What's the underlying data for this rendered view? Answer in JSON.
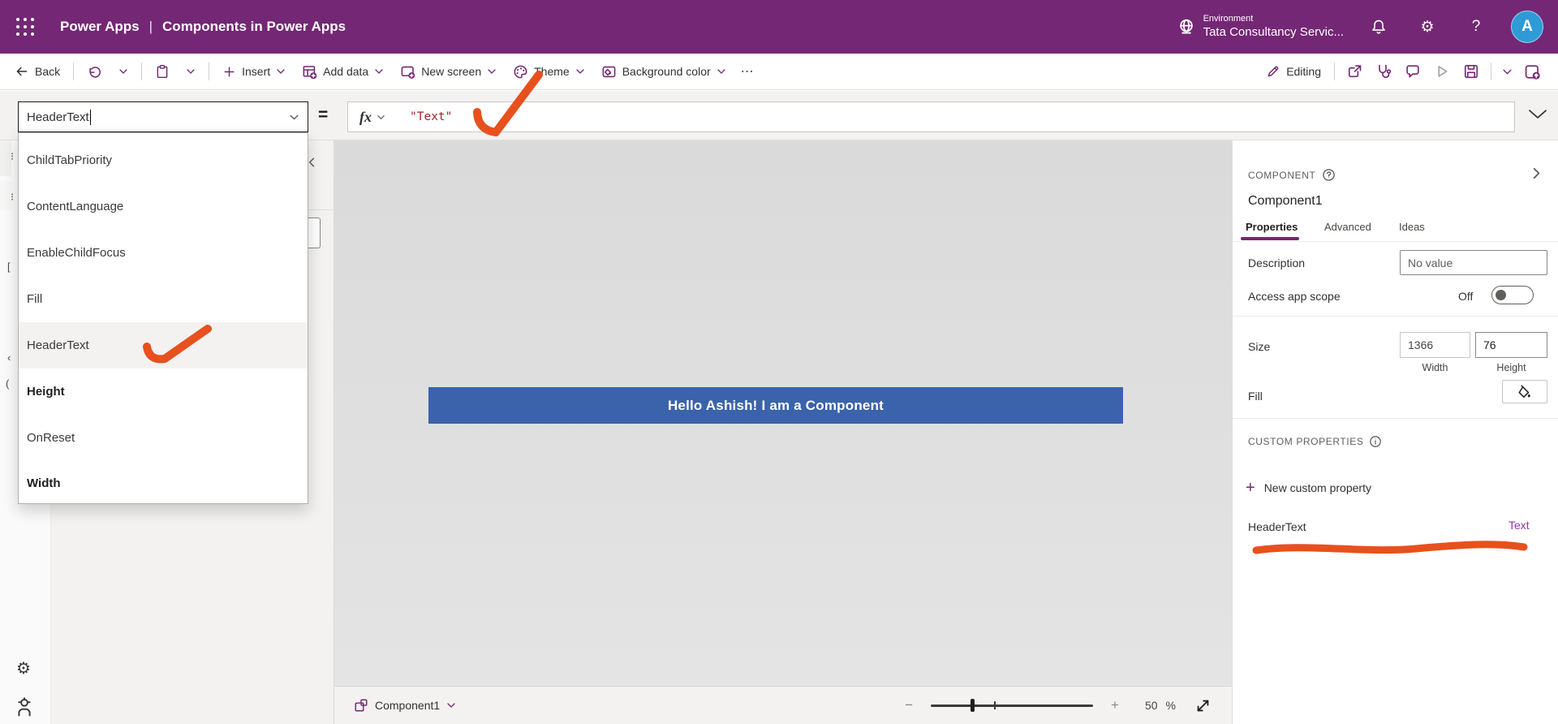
{
  "app": {
    "product": "Power Apps",
    "separator": "|",
    "title": "Components in Power Apps"
  },
  "environment": {
    "label": "Environment",
    "name": "Tata Consultancy Servic..."
  },
  "account": {
    "avatar_initial": "A",
    "help_glyph": "?"
  },
  "toolbar": {
    "back": "Back",
    "insert": "Insert",
    "add_data": "Add data",
    "new_screen": "New screen",
    "theme": "Theme",
    "background_color": "Background color",
    "overflow": "⋯",
    "editing": "Editing"
  },
  "formula_bar": {
    "property_value": "HeaderText",
    "equals": "=",
    "fx_label": "fx",
    "formula": "\"Text\""
  },
  "property_dropdown": {
    "items": [
      {
        "label": "ChildTabPriority",
        "bold": false,
        "selected": false
      },
      {
        "label": "ContentLanguage",
        "bold": false,
        "selected": false
      },
      {
        "label": "EnableChildFocus",
        "bold": false,
        "selected": false
      },
      {
        "label": "Fill",
        "bold": false,
        "selected": false
      },
      {
        "label": "HeaderText",
        "bold": false,
        "selected": true
      },
      {
        "label": "Height",
        "bold": true,
        "selected": false
      },
      {
        "label": "OnReset",
        "bold": false,
        "selected": false
      },
      {
        "label": "Width",
        "bold": true,
        "selected": false
      }
    ]
  },
  "canvas": {
    "component_text": "Hello Ashish! I am a Component",
    "component_fill": "#3b63ac"
  },
  "right_panel": {
    "header": "COMPONENT",
    "component_name": "Component1",
    "tabs": [
      "Properties",
      "Advanced",
      "Ideas"
    ],
    "active_tab": "Properties",
    "properties": {
      "description_label": "Description",
      "description_placeholder": "No value",
      "access_app_scope_label": "Access app scope",
      "access_app_scope_value": "Off",
      "size_label": "Size",
      "width_value": "1366",
      "height_value": "76",
      "width_caption": "Width",
      "height_caption": "Height",
      "fill_label": "Fill"
    },
    "custom_properties": {
      "title": "CUSTOM PROPERTIES",
      "new_label": "New custom property",
      "plus_glyph": "+",
      "rows": [
        {
          "name": "HeaderText",
          "type": "Text"
        }
      ]
    }
  },
  "bottom_bar": {
    "selected_screen": "Component1",
    "zoom_value": "50",
    "percent": "%",
    "minus": "−",
    "plus": "+"
  },
  "annotations": {
    "color": "#e8501d",
    "marks": [
      "check-on-formula-text",
      "check-on-headertext-item",
      "underline-custom-property-row"
    ]
  },
  "colors": {
    "brand_purple": "#742774",
    "formula_text_red": "#a4262c",
    "component_blue": "#3b63ac",
    "custom_type_purple": "#8f35b0"
  }
}
